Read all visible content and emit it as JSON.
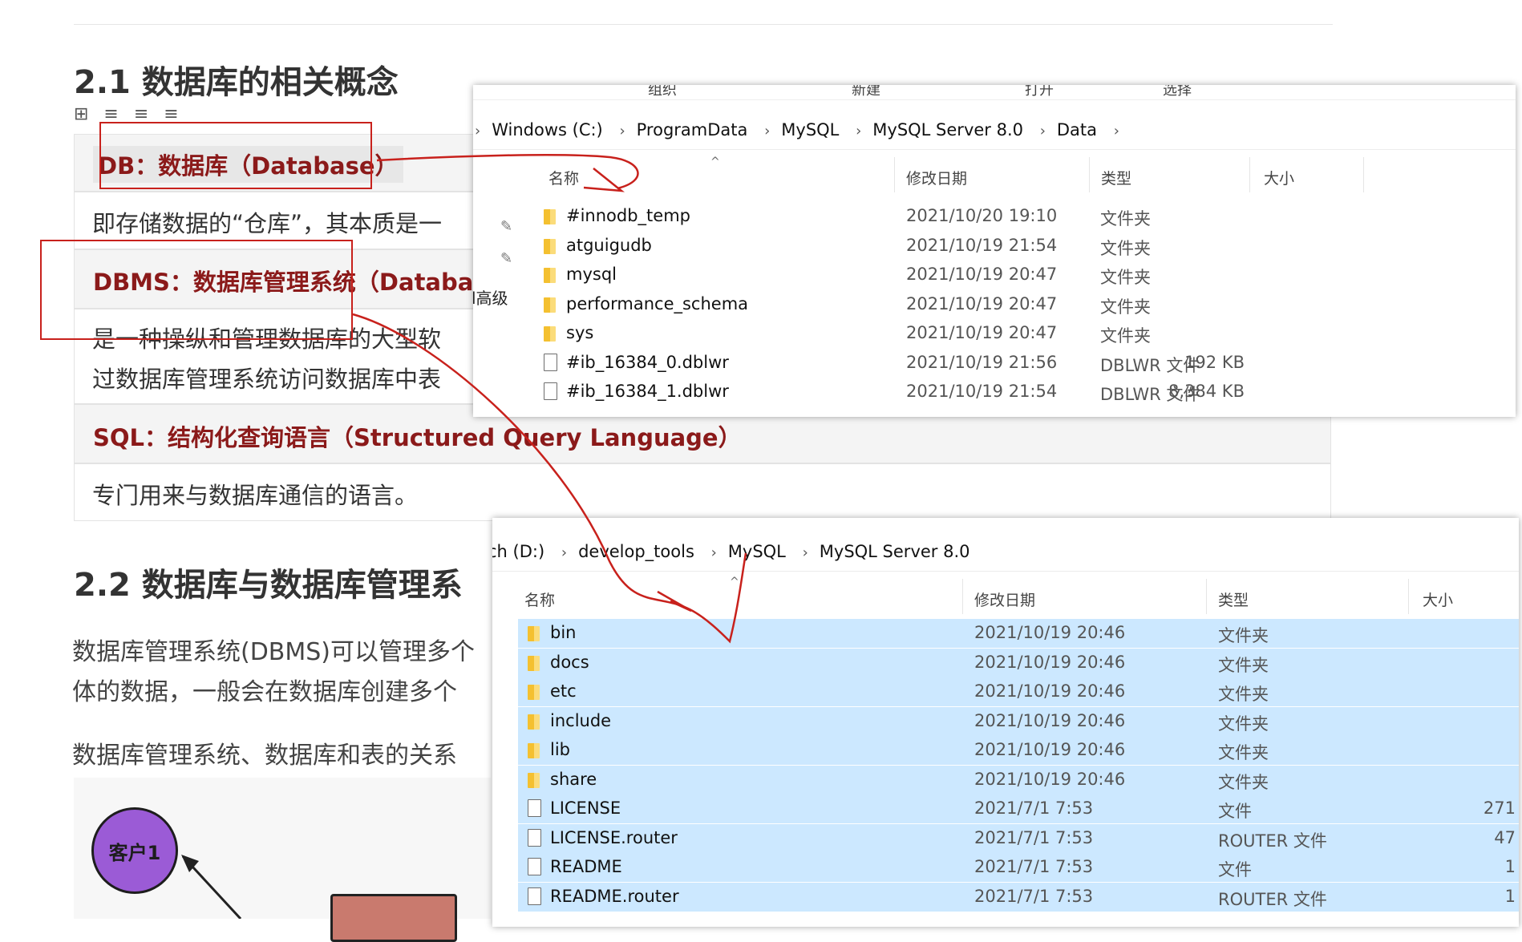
{
  "doc": {
    "section1_title": "2.1 数据库的相关概念",
    "toolbar_icons": "⊞ ≡ ≡ ≡",
    "db_term": "DB：数据库（Database）",
    "db_desc": "即存储数据的“仓库”，其本质是一",
    "dbms_term": "DBMS：数据库管理系统（Databa",
    "dbms_desc_1": "是一种操纵和管理数据库的大型软",
    "dbms_desc_2": "过数据库管理系统访问数据库中表",
    "sql_term": "SQL：结构化查询语言（Structured Query Language）",
    "sql_desc": "专门用来与数据库通信的语言。",
    "section2_title": "2.2 数据库与数据库管理系",
    "para1_line1": "数据库管理系统(DBMS)可以管理多个",
    "para1_line2": "体的数据，一般会在数据库创建多个",
    "para2": "数据库管理系统、数据库和表的关系",
    "client_label": "客户1",
    "sidebar_peek": "l高级"
  },
  "win1": {
    "ribbon": [
      "组织",
      "新建",
      "打开",
      "选择"
    ],
    "breadcrumb": [
      "Windows (C:)",
      "ProgramData",
      "MySQL",
      "MySQL Server 8.0",
      "Data"
    ],
    "columns": [
      "名称",
      "修改日期",
      "类型",
      "大小"
    ],
    "rows": [
      {
        "icon": "folder-icon",
        "name": "#innodb_temp",
        "date": "2021/10/20 19:10",
        "type": "文件夹",
        "size": ""
      },
      {
        "icon": "folder-icon",
        "name": "atguigudb",
        "date": "2021/10/19 21:54",
        "type": "文件夹",
        "size": ""
      },
      {
        "icon": "folder-icon",
        "name": "mysql",
        "date": "2021/10/19 20:47",
        "type": "文件夹",
        "size": ""
      },
      {
        "icon": "folder-icon",
        "name": "performance_schema",
        "date": "2021/10/19 20:47",
        "type": "文件夹",
        "size": ""
      },
      {
        "icon": "folder-icon",
        "name": "sys",
        "date": "2021/10/19 20:47",
        "type": "文件夹",
        "size": ""
      },
      {
        "icon": "file-icon",
        "name": "#ib_16384_0.dblwr",
        "date": "2021/10/19 21:56",
        "type": "DBLWR 文件",
        "size": "192 KB"
      },
      {
        "icon": "file-icon",
        "name": "#ib_16384_1.dblwr",
        "date": "2021/10/19 21:54",
        "type": "DBLWR 文件",
        "size": "8,384 KB"
      }
    ]
  },
  "win2": {
    "breadcrumb": [
      "ch (D:)",
      "develop_tools",
      "MySQL",
      "MySQL Server 8.0"
    ],
    "columns": [
      "名称",
      "修改日期",
      "类型",
      "大小"
    ],
    "rows": [
      {
        "icon": "folder-icon",
        "name": "bin",
        "date": "2021/10/19 20:46",
        "type": "文件夹",
        "size": ""
      },
      {
        "icon": "folder-icon",
        "name": "docs",
        "date": "2021/10/19 20:46",
        "type": "文件夹",
        "size": ""
      },
      {
        "icon": "folder-icon",
        "name": "etc",
        "date": "2021/10/19 20:46",
        "type": "文件夹",
        "size": ""
      },
      {
        "icon": "folder-icon",
        "name": "include",
        "date": "2021/10/19 20:46",
        "type": "文件夹",
        "size": ""
      },
      {
        "icon": "folder-icon",
        "name": "lib",
        "date": "2021/10/19 20:46",
        "type": "文件夹",
        "size": ""
      },
      {
        "icon": "folder-icon",
        "name": "share",
        "date": "2021/10/19 20:46",
        "type": "文件夹",
        "size": ""
      },
      {
        "icon": "file-icon",
        "name": "LICENSE",
        "date": "2021/7/1 7:53",
        "type": "文件",
        "size": "271"
      },
      {
        "icon": "file-icon",
        "name": "LICENSE.router",
        "date": "2021/7/1 7:53",
        "type": "ROUTER 文件",
        "size": "47"
      },
      {
        "icon": "file-icon",
        "name": "README",
        "date": "2021/7/1 7:53",
        "type": "文件",
        "size": "1"
      },
      {
        "icon": "file-icon",
        "name": "README.router",
        "date": "2021/7/1 7:53",
        "type": "ROUTER 文件",
        "size": "1"
      }
    ]
  },
  "colors": {
    "annotation_red": "#c8211c",
    "term_red": "#8b1a1a",
    "selection_blue": "#cce8ff",
    "folder_yellow": "#f4c030"
  }
}
